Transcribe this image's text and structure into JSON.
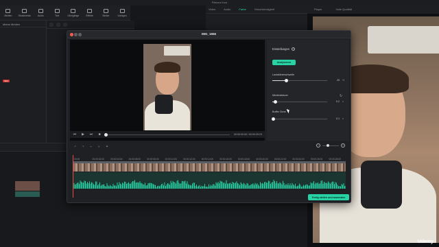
{
  "app": {
    "window_title": "Filmora Kurs"
  },
  "toolbar": {
    "items": [
      {
        "label": "Medien",
        "icon": "media-icon"
      },
      {
        "label": "Stockmedia",
        "icon": "stock-icon"
      },
      {
        "label": "Audio",
        "icon": "audio-icon"
      },
      {
        "label": "Text",
        "icon": "text-icon"
      },
      {
        "label": "Übergänge",
        "icon": "transition-icon"
      },
      {
        "label": "Effekte",
        "icon": "effects-icon"
      },
      {
        "label": "Sticker",
        "icon": "sticker-icon"
      },
      {
        "label": "Vorlagen",
        "icon": "template-icon"
      }
    ]
  },
  "left_panel": {
    "header": "Meine Medien",
    "badge": "NEU"
  },
  "right_panel": {
    "tabs": [
      "Video",
      "Audio",
      "Farbe",
      "Geschwindigkeit"
    ],
    "active_tab": "Farbe"
  },
  "player": {
    "label": "Player",
    "quality": "Volle Qualität"
  },
  "watermark": "Udemy",
  "dialog": {
    "title": "IMG_1656",
    "settings_title": "Einstellungen",
    "analyze_label": "Analysieren",
    "volume_threshold": {
      "label": "Lautstärkeschwelle",
      "value": "25",
      "unit": "%",
      "level": 0.25
    },
    "min_duration": {
      "label": "Mindestdauer",
      "value": "0.2",
      "unit": "s",
      "level": 0.05
    },
    "buffer_zone": {
      "label": "Buffer Zone",
      "value": "0.1",
      "unit": "s",
      "level": 0.02
    },
    "timecode": "00:00:00:00 / 00:00:29:23",
    "ruler": [
      "00:00",
      "00:00:02:00",
      "00:00:04:00",
      "00:00:06:00",
      "00:00:08:00",
      "00:00:10:00",
      "00:00:12:00",
      "00:00:14:00",
      "00:00:16:00",
      "00:00:18:00",
      "00:00:20:00",
      "00:00:22:00",
      "00:00:24:00",
      "00:00:26:00",
      "00:00:28:00"
    ],
    "finish_label": "Fertig stellen und anwenden"
  }
}
